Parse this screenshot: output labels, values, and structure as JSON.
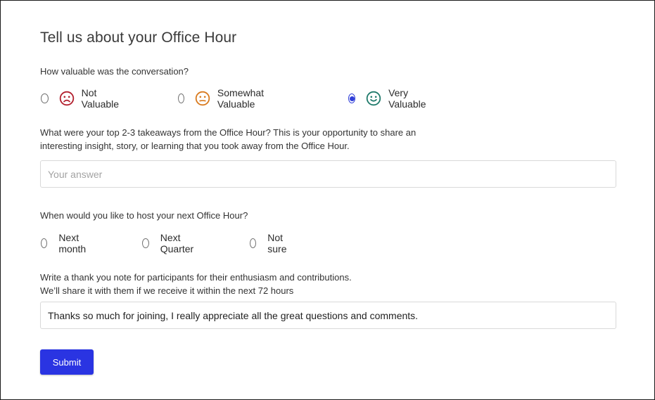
{
  "form": {
    "title": "Tell us about your Office Hour",
    "q1": {
      "label": "How valuable was the conversation?",
      "options": [
        {
          "label": "Not Valuable",
          "icon": "frown-face-icon",
          "color": "#b21f2d",
          "checked": false
        },
        {
          "label": "Somewhat Valuable",
          "icon": "neutral-face-icon",
          "color": "#d97a1e",
          "checked": false
        },
        {
          "label": "Very Valuable",
          "icon": "smile-face-icon",
          "color": "#1f7a6b",
          "checked": true
        }
      ]
    },
    "q2": {
      "label_line1": "What were your top 2-3 takeaways from the Office Hour? This is your opportunity to share an",
      "label_line2": "interesting insight, story, or learning that you took away from the Office Hour.",
      "placeholder": "Your answer",
      "value": ""
    },
    "q3": {
      "label": "When would you like to host your next Office Hour?",
      "options": [
        {
          "label": "Next month",
          "checked": false
        },
        {
          "label": "Next Quarter",
          "checked": false
        },
        {
          "label": "Not sure",
          "checked": false
        }
      ]
    },
    "q4": {
      "label_line1": "Write a thank you note for participants for their enthusiasm and contributions.",
      "label_line2": "We’ll share it with them if we receive it within the next 72 hours",
      "value": "Thanks so much for joining, I really appreciate all the great questions and comments."
    },
    "submit_label": "Submit"
  },
  "colors": {
    "accent": "#2a34e2",
    "radio_checked": "#2f3ed8"
  }
}
